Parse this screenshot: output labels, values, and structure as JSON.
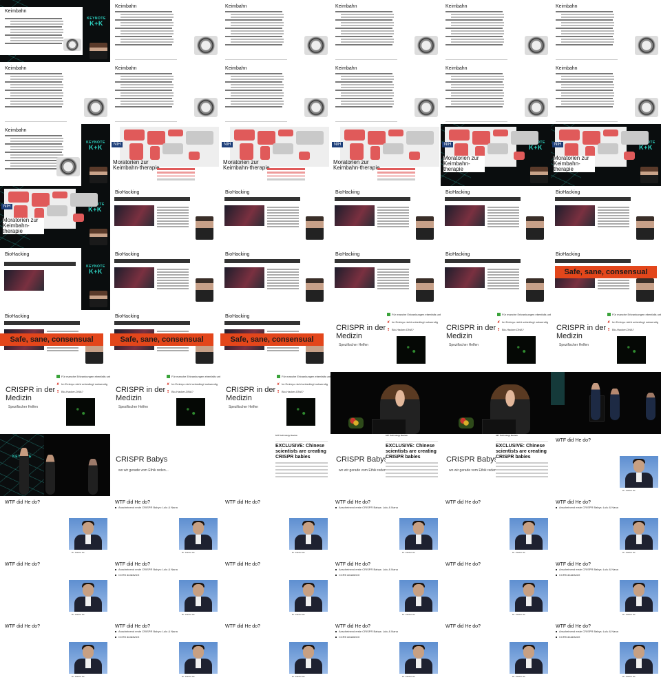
{
  "rows": [
    [
      {
        "kind": "keimbahn",
        "title": "Keimbahn",
        "cam": false
      },
      {
        "kind": "keimbahn",
        "title": "Keimbahn",
        "cam": true,
        "bg": "web"
      },
      {
        "kind": "keimbahn",
        "title": "Keimbahn",
        "cam": true,
        "bg": "web"
      },
      {
        "kind": "keimbahn",
        "title": "Keimbahn",
        "cam": true,
        "bg": "web"
      },
      {
        "kind": "keimbahn",
        "title": "Keimbahn",
        "cam": true,
        "bg": "web"
      },
      {
        "kind": "keimbahn",
        "title": "Keimbahn",
        "cam": true,
        "bg": "web"
      }
    ],
    [
      {
        "kind": "keimbahn",
        "title": "Keimbahn",
        "cam": false
      },
      {
        "kind": "keimbahn",
        "title": "Keimbahn",
        "cam": false
      },
      {
        "kind": "keimbahn",
        "title": "Keimbahn",
        "cam": false
      },
      {
        "kind": "keimbahn",
        "title": "Keimbahn",
        "cam": false
      },
      {
        "kind": "keimbahn",
        "title": "Keimbahn",
        "cam": false
      },
      {
        "kind": "keimbahn",
        "title": "Keimbahn",
        "cam": false
      }
    ],
    [
      {
        "kind": "keimbahn",
        "title": "Keimbahn",
        "cam": false
      },
      {
        "kind": "map",
        "caption": "Moratorien zur Keimbahn-therapie",
        "nih": "NIH"
      },
      {
        "kind": "map",
        "caption": "Moratorien zur Keimbahn-therapie",
        "nih": "NIH"
      },
      {
        "kind": "map",
        "caption": "Moratorien zur Keimbahn-therapie",
        "nih": "NIH"
      },
      {
        "kind": "map",
        "caption": "Moratorien zur Keimbahn-therapie",
        "nih": "NIH",
        "cam": true
      },
      {
        "kind": "map",
        "caption": "Moratorien zur Keimbahn-therapie",
        "nih": "NIH",
        "cam": true
      }
    ],
    [
      {
        "kind": "map",
        "caption": "Moratorien zur Keimbahn-therapie",
        "nih": "NIH",
        "cam": true
      },
      {
        "kind": "bio",
        "title": "BioHacking"
      },
      {
        "kind": "bio",
        "title": "BioHacking"
      },
      {
        "kind": "bio",
        "title": "BioHacking"
      },
      {
        "kind": "bio",
        "title": "BioHacking"
      },
      {
        "kind": "bio",
        "title": "BioHacking"
      }
    ],
    [
      {
        "kind": "bio",
        "title": "BioHacking",
        "cam": true
      },
      {
        "kind": "bio",
        "title": "BioHacking"
      },
      {
        "kind": "bio",
        "title": "BioHacking"
      },
      {
        "kind": "bio",
        "title": "BioHacking"
      },
      {
        "kind": "bio",
        "title": "BioHacking"
      },
      {
        "kind": "bio",
        "title": "BioHacking",
        "banner": "Safe, sane, consensual"
      }
    ],
    [
      {
        "kind": "bio",
        "title": "BioHacking",
        "banner": "Safe, sane, consensual"
      },
      {
        "kind": "bio",
        "title": "BioHacking",
        "banner": "Safe, sane, consensual"
      },
      {
        "kind": "bio",
        "title": "BioHacking",
        "banner": "Safe, sane, consensual"
      },
      {
        "kind": "med",
        "title": "CRISPR in der Medizin",
        "sub": "Spezifischer Helfen"
      },
      {
        "kind": "med",
        "title": "CRISPR in der Medizin",
        "sub": "Spezifischer Helfen"
      },
      {
        "kind": "med",
        "title": "CRISPR in der Medizin",
        "sub": "Spezifischer Helfen"
      }
    ],
    [
      {
        "kind": "med",
        "title": "CRISPR in der Medizin",
        "sub": "Spezifischer Helfen"
      },
      {
        "kind": "med",
        "title": "CRISPR in der Medizin",
        "sub": "Spezifischer Helfen"
      },
      {
        "kind": "med",
        "title": "CRISPR in der Medizin",
        "sub": "Spezifischer Helfen"
      },
      {
        "kind": "stage",
        "variant": "one"
      },
      {
        "kind": "stage",
        "variant": "two"
      },
      {
        "kind": "stage",
        "variant": "three"
      }
    ],
    [
      {
        "kind": "stage",
        "variant": "four"
      },
      {
        "kind": "babys",
        "title": "CRISPR Babys",
        "sub": "wo wir gerade vom Ethik reden..."
      },
      {
        "kind": "babys",
        "title": "",
        "sub": "",
        "doc": true
      },
      {
        "kind": "babys",
        "title": "CRISPR Babys",
        "sub": "wo wir gerade vom Ethik reden...",
        "doc": true
      },
      {
        "kind": "babys",
        "title": "CRISPR Babys",
        "sub": "wo wir gerade vom Ethik reden...",
        "doc": true
      },
      {
        "kind": "wtf",
        "title": "WTF did He do?",
        "bullets": []
      }
    ],
    [
      {
        "kind": "wtf",
        "title": "WTF did He do?",
        "bullets": []
      },
      {
        "kind": "wtf",
        "title": "WTF did He do?",
        "bullets": [
          "Anscheinend erste CRISPR Babys: Lulu & Nana"
        ]
      },
      {
        "kind": "wtf",
        "title": "WTF did He do?",
        "bullets": []
      },
      {
        "kind": "wtf",
        "title": "WTF did He do?",
        "bullets": [
          "Anscheinend erste CRISPR Babys: Lulu & Nana"
        ]
      },
      {
        "kind": "wtf",
        "title": "WTF did He do?",
        "bullets": []
      },
      {
        "kind": "wtf",
        "title": "WTF did He do?",
        "bullets": [
          "Anscheinend erste CRISPR Babys: Lulu & Nana"
        ]
      }
    ],
    [
      {
        "kind": "wtf",
        "title": "WTF did He do?",
        "bullets": []
      },
      {
        "kind": "wtf",
        "title": "WTF did He do?",
        "bullets": [
          "Anscheinend erste CRISPR Babys: Lulu & Nana",
          "CCR5 deaktiviert"
        ]
      },
      {
        "kind": "wtf",
        "title": "WTF did He do?",
        "bullets": []
      },
      {
        "kind": "wtf",
        "title": "WTF did He do?",
        "bullets": [
          "Anscheinend erste CRISPR Babys: Lulu & Nana",
          "CCR5 deaktiviert"
        ]
      },
      {
        "kind": "wtf",
        "title": "WTF did He do?",
        "bullets": []
      },
      {
        "kind": "wtf",
        "title": "WTF did He do?",
        "bullets": [
          "Anscheinend erste CRISPR Babys: Lulu & Nana",
          "CCR5 deaktiviert"
        ]
      }
    ],
    [
      {
        "kind": "wtf",
        "title": "WTF did He do?",
        "bullets": []
      },
      {
        "kind": "wtf",
        "title": "WTF did He do?",
        "bullets": [
          "Anscheinend erste CRISPR Babys: Lulu & Nana",
          "CCR5 deaktiviert"
        ]
      },
      {
        "kind": "wtf",
        "title": "WTF did He do?",
        "bullets": []
      },
      {
        "kind": "wtf",
        "title": "WTF did He do?",
        "bullets": [
          "Anscheinend erste CRISPR Babys: Lulu & Nana",
          "CCR5 deaktiviert"
        ]
      },
      {
        "kind": "wtf",
        "title": "WTF did He do?",
        "bullets": []
      },
      {
        "kind": "wtf",
        "title": "WTF did He do?",
        "bullets": [
          "Anscheinend erste CRISPR Babys: Lulu & Nana",
          "CCR5 deaktiviert"
        ]
      }
    ]
  ],
  "med_checklist": [
    "Für manche Erkrankungen ebenfalls unbekannt",
    "Im Embryo nicht unbedingt notwendig",
    "Bio-Hacker-DNA?"
  ],
  "doc_headline": "EXCLUSIVE: Chinese scientists are creating CRISPR babies",
  "doc_kicker": "MIT Technology Review",
  "keynote_logo": "KEYNOTE",
  "keynote_sub": "K+K",
  "he_caption": "Dr. Jiankui He",
  "colors": {
    "banner": "#e3461b",
    "map_red": "#e05a5a",
    "nih_blue": "#1d3f7a",
    "accent_teal": "#2fd7c6"
  }
}
